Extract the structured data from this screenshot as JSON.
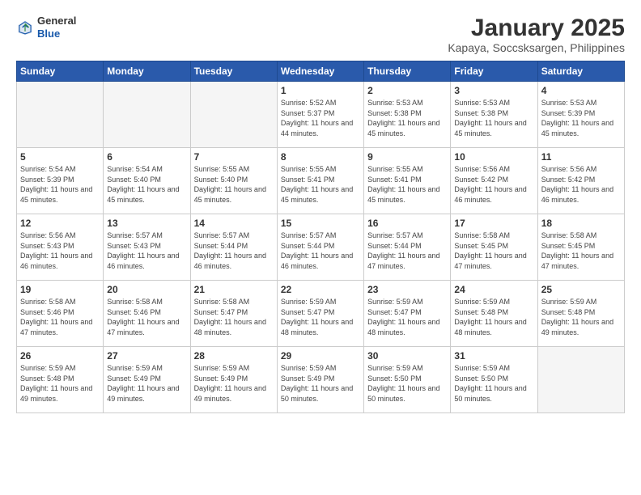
{
  "header": {
    "logo": {
      "general": "General",
      "blue": "Blue"
    },
    "title": "January 2025",
    "subtitle": "Kapaya, Soccsksargen, Philippines"
  },
  "days_of_week": [
    "Sunday",
    "Monday",
    "Tuesday",
    "Wednesday",
    "Thursday",
    "Friday",
    "Saturday"
  ],
  "weeks": [
    [
      {
        "day": "",
        "info": ""
      },
      {
        "day": "",
        "info": ""
      },
      {
        "day": "",
        "info": ""
      },
      {
        "day": "1",
        "info": "Sunrise: 5:52 AM\nSunset: 5:37 PM\nDaylight: 11 hours\nand 44 minutes."
      },
      {
        "day": "2",
        "info": "Sunrise: 5:53 AM\nSunset: 5:38 PM\nDaylight: 11 hours\nand 45 minutes."
      },
      {
        "day": "3",
        "info": "Sunrise: 5:53 AM\nSunset: 5:38 PM\nDaylight: 11 hours\nand 45 minutes."
      },
      {
        "day": "4",
        "info": "Sunrise: 5:53 AM\nSunset: 5:39 PM\nDaylight: 11 hours\nand 45 minutes."
      }
    ],
    [
      {
        "day": "5",
        "info": "Sunrise: 5:54 AM\nSunset: 5:39 PM\nDaylight: 11 hours\nand 45 minutes."
      },
      {
        "day": "6",
        "info": "Sunrise: 5:54 AM\nSunset: 5:40 PM\nDaylight: 11 hours\nand 45 minutes."
      },
      {
        "day": "7",
        "info": "Sunrise: 5:55 AM\nSunset: 5:40 PM\nDaylight: 11 hours\nand 45 minutes."
      },
      {
        "day": "8",
        "info": "Sunrise: 5:55 AM\nSunset: 5:41 PM\nDaylight: 11 hours\nand 45 minutes."
      },
      {
        "day": "9",
        "info": "Sunrise: 5:55 AM\nSunset: 5:41 PM\nDaylight: 11 hours\nand 45 minutes."
      },
      {
        "day": "10",
        "info": "Sunrise: 5:56 AM\nSunset: 5:42 PM\nDaylight: 11 hours\nand 46 minutes."
      },
      {
        "day": "11",
        "info": "Sunrise: 5:56 AM\nSunset: 5:42 PM\nDaylight: 11 hours\nand 46 minutes."
      }
    ],
    [
      {
        "day": "12",
        "info": "Sunrise: 5:56 AM\nSunset: 5:43 PM\nDaylight: 11 hours\nand 46 minutes."
      },
      {
        "day": "13",
        "info": "Sunrise: 5:57 AM\nSunset: 5:43 PM\nDaylight: 11 hours\nand 46 minutes."
      },
      {
        "day": "14",
        "info": "Sunrise: 5:57 AM\nSunset: 5:44 PM\nDaylight: 11 hours\nand 46 minutes."
      },
      {
        "day": "15",
        "info": "Sunrise: 5:57 AM\nSunset: 5:44 PM\nDaylight: 11 hours\nand 46 minutes."
      },
      {
        "day": "16",
        "info": "Sunrise: 5:57 AM\nSunset: 5:44 PM\nDaylight: 11 hours\nand 47 minutes."
      },
      {
        "day": "17",
        "info": "Sunrise: 5:58 AM\nSunset: 5:45 PM\nDaylight: 11 hours\nand 47 minutes."
      },
      {
        "day": "18",
        "info": "Sunrise: 5:58 AM\nSunset: 5:45 PM\nDaylight: 11 hours\nand 47 minutes."
      }
    ],
    [
      {
        "day": "19",
        "info": "Sunrise: 5:58 AM\nSunset: 5:46 PM\nDaylight: 11 hours\nand 47 minutes."
      },
      {
        "day": "20",
        "info": "Sunrise: 5:58 AM\nSunset: 5:46 PM\nDaylight: 11 hours\nand 47 minutes."
      },
      {
        "day": "21",
        "info": "Sunrise: 5:58 AM\nSunset: 5:47 PM\nDaylight: 11 hours\nand 48 minutes."
      },
      {
        "day": "22",
        "info": "Sunrise: 5:59 AM\nSunset: 5:47 PM\nDaylight: 11 hours\nand 48 minutes."
      },
      {
        "day": "23",
        "info": "Sunrise: 5:59 AM\nSunset: 5:47 PM\nDaylight: 11 hours\nand 48 minutes."
      },
      {
        "day": "24",
        "info": "Sunrise: 5:59 AM\nSunset: 5:48 PM\nDaylight: 11 hours\nand 48 minutes."
      },
      {
        "day": "25",
        "info": "Sunrise: 5:59 AM\nSunset: 5:48 PM\nDaylight: 11 hours\nand 49 minutes."
      }
    ],
    [
      {
        "day": "26",
        "info": "Sunrise: 5:59 AM\nSunset: 5:48 PM\nDaylight: 11 hours\nand 49 minutes."
      },
      {
        "day": "27",
        "info": "Sunrise: 5:59 AM\nSunset: 5:49 PM\nDaylight: 11 hours\nand 49 minutes."
      },
      {
        "day": "28",
        "info": "Sunrise: 5:59 AM\nSunset: 5:49 PM\nDaylight: 11 hours\nand 49 minutes."
      },
      {
        "day": "29",
        "info": "Sunrise: 5:59 AM\nSunset: 5:49 PM\nDaylight: 11 hours\nand 50 minutes."
      },
      {
        "day": "30",
        "info": "Sunrise: 5:59 AM\nSunset: 5:50 PM\nDaylight: 11 hours\nand 50 minutes."
      },
      {
        "day": "31",
        "info": "Sunrise: 5:59 AM\nSunset: 5:50 PM\nDaylight: 11 hours\nand 50 minutes."
      },
      {
        "day": "",
        "info": ""
      }
    ]
  ]
}
